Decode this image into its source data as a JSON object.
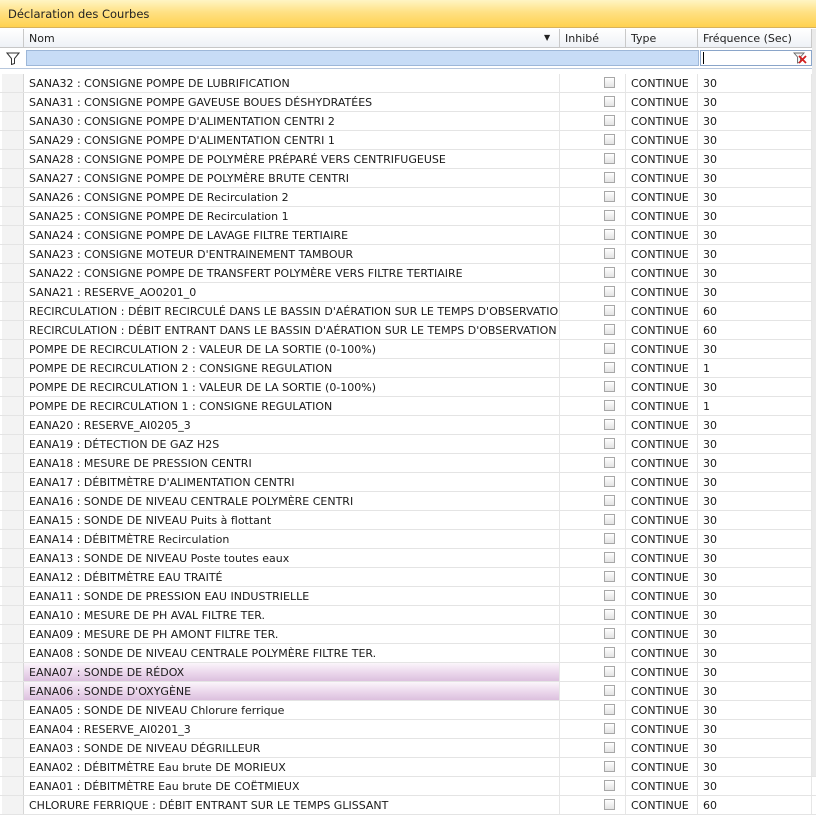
{
  "window": {
    "title": "Déclaration des Courbes"
  },
  "columns": {
    "nom": "Nom",
    "inhibe": "Inhibé",
    "type": "Type",
    "frequence": "Fréquence (Sec)"
  },
  "filter": {
    "value": ""
  },
  "rows": [
    {
      "nom": "SANA32 : CONSIGNE POMPE DE LUBRIFICATION",
      "type": "CONTINUE",
      "freq": "30"
    },
    {
      "nom": "SANA31 : CONSIGNE POMPE GAVEUSE BOUES DÉSHYDRATÉES",
      "type": "CONTINUE",
      "freq": "30"
    },
    {
      "nom": "SANA30 : CONSIGNE POMPE D'ALIMENTATION CENTRI 2",
      "type": "CONTINUE",
      "freq": "30"
    },
    {
      "nom": "SANA29 : CONSIGNE POMPE D'ALIMENTATION CENTRI 1",
      "type": "CONTINUE",
      "freq": "30"
    },
    {
      "nom": "SANA28 : CONSIGNE POMPE DE POLYMÈRE PRÉPARÉ VERS CENTRIFUGEUSE",
      "type": "CONTINUE",
      "freq": "30"
    },
    {
      "nom": "SANA27 : CONSIGNE POMPE DE POLYMÈRE BRUTE CENTRI",
      "type": "CONTINUE",
      "freq": "30"
    },
    {
      "nom": "SANA26 : CONSIGNE POMPE DE Recirculation 2",
      "type": "CONTINUE",
      "freq": "30"
    },
    {
      "nom": "SANA25 : CONSIGNE POMPE DE Recirculation 1",
      "type": "CONTINUE",
      "freq": "30"
    },
    {
      "nom": "SANA24 : CONSIGNE POMPE DE LAVAGE FILTRE TERTIAIRE",
      "type": "CONTINUE",
      "freq": "30"
    },
    {
      "nom": "SANA23 : CONSIGNE MOTEUR D'ENTRAINEMENT TAMBOUR",
      "type": "CONTINUE",
      "freq": "30"
    },
    {
      "nom": "SANA22 : CONSIGNE POMPE DE TRANSFERT POLYMÈRE VERS FILTRE TERTIAIRE",
      "type": "CONTINUE",
      "freq": "30"
    },
    {
      "nom": "SANA21 : RESERVE_AO0201_0",
      "type": "CONTINUE",
      "freq": "30"
    },
    {
      "nom": "RECIRCULATION : DÉBIT RECIRCULÉ DANS LE BASSIN D'AÉRATION SUR LE TEMPS D'OBSERVATION",
      "type": "CONTINUE",
      "freq": "60"
    },
    {
      "nom": "RECIRCULATION : DÉBIT ENTRANT DANS LE BASSIN D'AÉRATION SUR LE TEMPS D'OBSERVATION",
      "type": "CONTINUE",
      "freq": "60"
    },
    {
      "nom": "POMPE DE RECIRCULATION 2 : VALEUR DE LA SORTIE (0-100%)",
      "type": "CONTINUE",
      "freq": "30"
    },
    {
      "nom": "POMPE DE RECIRCULATION 2 : CONSIGNE REGULATION",
      "type": "CONTINUE",
      "freq": "1"
    },
    {
      "nom": "POMPE DE RECIRCULATION 1 : VALEUR DE LA SORTIE (0-100%)",
      "type": "CONTINUE",
      "freq": "30"
    },
    {
      "nom": "POMPE DE RECIRCULATION 1 : CONSIGNE REGULATION",
      "type": "CONTINUE",
      "freq": "1"
    },
    {
      "nom": "EANA20 : RESERVE_AI0205_3",
      "type": "CONTINUE",
      "freq": "30"
    },
    {
      "nom": "EANA19 : DÉTECTION DE GAZ H2S",
      "type": "CONTINUE",
      "freq": "30"
    },
    {
      "nom": "EANA18 : MESURE DE PRESSION CENTRI",
      "type": "CONTINUE",
      "freq": "30"
    },
    {
      "nom": "EANA17 : DÉBITMÈTRE D'ALIMENTATION CENTRI",
      "type": "CONTINUE",
      "freq": "30"
    },
    {
      "nom": "EANA16 : SONDE DE NIVEAU CENTRALE POLYMÈRE CENTRI",
      "type": "CONTINUE",
      "freq": "30"
    },
    {
      "nom": "EANA15 : SONDE DE NIVEAU Puits à flottant",
      "type": "CONTINUE",
      "freq": "30"
    },
    {
      "nom": "EANA14 : DÉBITMÈTRE Recirculation",
      "type": "CONTINUE",
      "freq": "30"
    },
    {
      "nom": "EANA13 : SONDE DE NIVEAU Poste toutes eaux",
      "type": "CONTINUE",
      "freq": "30"
    },
    {
      "nom": "EANA12 : DÉBITMÈTRE EAU TRAITÉ",
      "type": "CONTINUE",
      "freq": "30"
    },
    {
      "nom": "EANA11 : SONDE DE PRESSION EAU INDUSTRIELLE",
      "type": "CONTINUE",
      "freq": "30"
    },
    {
      "nom": "EANA10 : MESURE DE PH AVAL FILTRE TER.",
      "type": "CONTINUE",
      "freq": "30"
    },
    {
      "nom": "EANA09 : MESURE DE PH AMONT FILTRE TER.",
      "type": "CONTINUE",
      "freq": "30"
    },
    {
      "nom": "EANA08 : SONDE DE NIVEAU CENTRALE POLYMÈRE FILTRE TER.",
      "type": "CONTINUE",
      "freq": "30"
    },
    {
      "nom": "EANA07 : SONDE DE RÉDOX",
      "type": "CONTINUE",
      "freq": "30",
      "selected": true
    },
    {
      "nom": "EANA06 : SONDE D'OXYGÈNE",
      "type": "CONTINUE",
      "freq": "30",
      "selected": true
    },
    {
      "nom": "EANA05 : SONDE DE NIVEAU Chlorure ferrique",
      "type": "CONTINUE",
      "freq": "30"
    },
    {
      "nom": "EANA04 : RESERVE_AI0201_3",
      "type": "CONTINUE",
      "freq": "30"
    },
    {
      "nom": "EANA03 : SONDE DE NIVEAU DÉGRILLEUR",
      "type": "CONTINUE",
      "freq": "30"
    },
    {
      "nom": "EANA02 : DÉBITMÈTRE Eau brute DE MORIEUX",
      "type": "CONTINUE",
      "freq": "30"
    },
    {
      "nom": "EANA01 : DÉBITMÈTRE Eau brute DE COËTMIEUX",
      "type": "CONTINUE",
      "freq": "30"
    },
    {
      "nom": "CHLORURE FERRIQUE : DÉBIT ENTRANT SUR LE TEMPS GLISSANT",
      "type": "CONTINUE",
      "freq": "60"
    }
  ]
}
